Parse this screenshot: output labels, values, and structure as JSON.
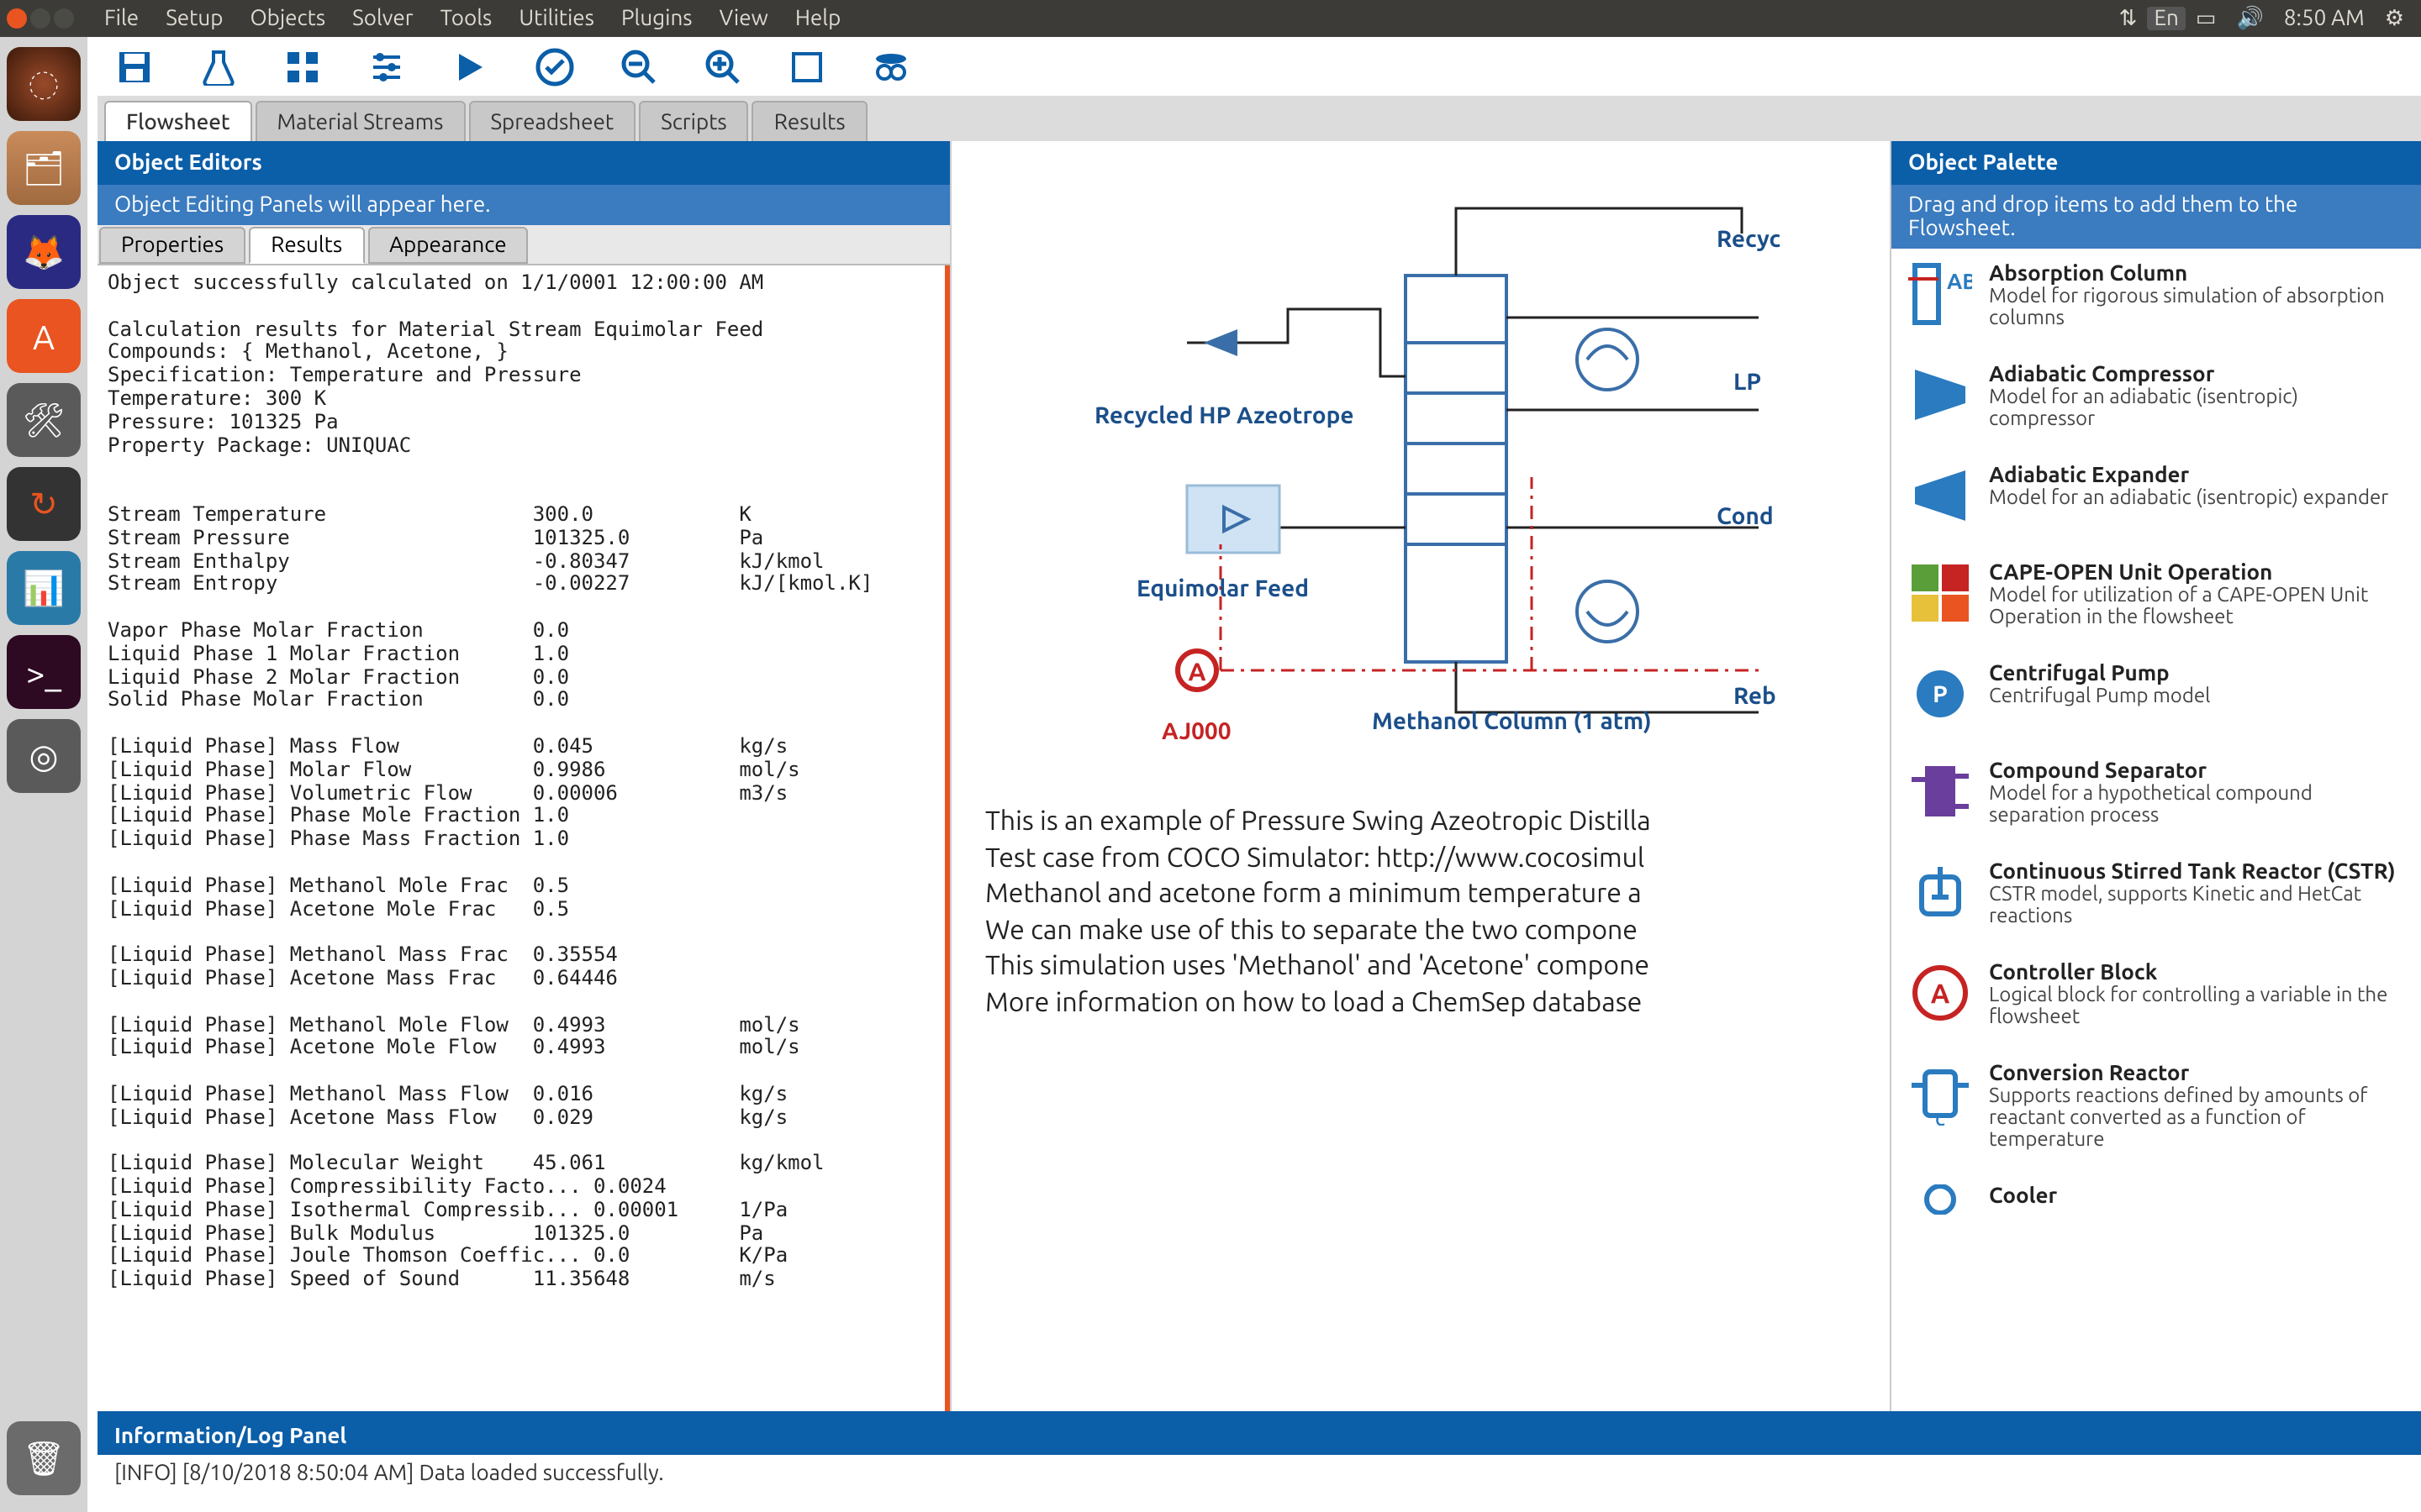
{
  "ubuntu": {
    "menus": [
      "File",
      "Setup",
      "Objects",
      "Solver",
      "Tools",
      "Utilities",
      "Plugins",
      "View",
      "Help"
    ],
    "clock": "8:50 AM",
    "lang": "En"
  },
  "toolbar_icons": [
    "save",
    "flask",
    "grid",
    "sliders",
    "play",
    "check",
    "zoom-out",
    "zoom-in",
    "fit",
    "spy"
  ],
  "tabs": [
    "Flowsheet",
    "Material Streams",
    "Spreadsheet",
    "Scripts",
    "Results"
  ],
  "active_tab": "Flowsheet",
  "left": {
    "header": "Object Editors",
    "sub": "Object Editing Panels will appear here.",
    "sub_tabs": [
      "Properties",
      "Results",
      "Appearance"
    ],
    "active_sub": "Results",
    "results_text": "Object successfully calculated on 1/1/0001 12:00:00 AM\n\nCalculation results for Material Stream Equimolar Feed\nCompounds: { Methanol, Acetone, }\nSpecification: Temperature and Pressure\nTemperature: 300 K\nPressure: 101325 Pa\nProperty Package: UNIQUAC\n\n\nStream Temperature                 300.0            K\nStream Pressure                    101325.0         Pa\nStream Enthalpy                    -0.80347         kJ/kmol\nStream Entropy                     -0.00227         kJ/[kmol.K]\n\nVapor Phase Molar Fraction         0.0\nLiquid Phase 1 Molar Fraction      1.0\nLiquid Phase 2 Molar Fraction      0.0\nSolid Phase Molar Fraction         0.0\n\n[Liquid Phase] Mass Flow           0.045            kg/s\n[Liquid Phase] Molar Flow          0.9986           mol/s\n[Liquid Phase] Volumetric Flow     0.00006          m3/s\n[Liquid Phase] Phase Mole Fraction 1.0\n[Liquid Phase] Phase Mass Fraction 1.0\n\n[Liquid Phase] Methanol Mole Frac  0.5\n[Liquid Phase] Acetone Mole Frac   0.5\n\n[Liquid Phase] Methanol Mass Frac  0.35554\n[Liquid Phase] Acetone Mass Frac   0.64446\n\n[Liquid Phase] Methanol Mole Flow  0.4993           mol/s\n[Liquid Phase] Acetone Mole Flow   0.4993           mol/s\n\n[Liquid Phase] Methanol Mass Flow  0.016            kg/s\n[Liquid Phase] Acetone Mass Flow   0.029            kg/s\n\n[Liquid Phase] Molecular Weight    45.061           kg/kmol\n[Liquid Phase] Compressibility Facto... 0.0024\n[Liquid Phase] Isothermal Compressib... 0.00001     1/Pa\n[Liquid Phase] Bulk Modulus        101325.0         Pa\n[Liquid Phase] Joule Thomson Coeffic... 0.0         K/Pa\n[Liquid Phase] Speed of Sound      11.35648         m/s\n"
  },
  "flowsheet": {
    "labels": {
      "recycled": "Recycled HP Azeotrope",
      "feed": "Equimolar Feed",
      "column": "Methanol Column (1 atm)",
      "recycle_top": "Recyc",
      "lp": "LP",
      "cond": "Cond",
      "reb": "Reb",
      "aj": "AJ000",
      "a_badge": "A"
    },
    "description": [
      "This is an example of Pressure Swing Azeotropic Distilla",
      "Test case from COCO Simulator: http://www.cocosimul",
      "Methanol and acetone form a minimum temperature a",
      "We can make use of this to separate the two compone",
      "This simulation uses 'Methanol' and 'Acetone' compone",
      "More information on how to load a ChemSep database"
    ]
  },
  "palette": {
    "header": "Object Palette",
    "sub": "Drag and drop items to add them to the Flowsheet.",
    "items": [
      {
        "title": "Absorption Column",
        "desc": "Model for rigorous simulation of absorption columns",
        "icon": "abs-col",
        "colors": [
          "#2a7bbf",
          "#c62323"
        ]
      },
      {
        "title": "Adiabatic Compressor",
        "desc": "Model for an adiabatic (isentropic) compressor",
        "icon": "compressor",
        "colors": [
          "#2a7bbf"
        ]
      },
      {
        "title": "Adiabatic Expander",
        "desc": "Model for an adiabatic (isentropic) expander",
        "icon": "expander",
        "colors": [
          "#2a7bbf"
        ]
      },
      {
        "title": "CAPE-OPEN Unit Operation",
        "desc": "Model for utilization of a CAPE-OPEN Unit Operation in the flowsheet",
        "icon": "capeopen",
        "colors": [
          "#5a9e3a",
          "#e95420",
          "#e7c13a"
        ]
      },
      {
        "title": "Centrifugal Pump",
        "desc": "Centrifugal Pump model",
        "icon": "pump",
        "colors": [
          "#2a7bbf"
        ]
      },
      {
        "title": "Compound Separator",
        "desc": "Model for a hypothetical compound separation process",
        "icon": "comp-sep",
        "colors": [
          "#6a3e9c"
        ]
      },
      {
        "title": "Continuous Stirred Tank Reactor (CSTR)",
        "desc": "CSTR model, supports Kinetic and HetCat reactions",
        "icon": "cstr",
        "colors": [
          "#2a7bbf"
        ]
      },
      {
        "title": "Controller Block",
        "desc": "Logical block for controlling a variable in the flowsheet",
        "icon": "controller",
        "colors": [
          "#c62323"
        ]
      },
      {
        "title": "Conversion Reactor",
        "desc": "Supports reactions defined by amounts of reactant converted as a function of temperature",
        "icon": "conv-react",
        "colors": [
          "#2a7bbf"
        ]
      },
      {
        "title": "Cooler",
        "desc": "",
        "icon": "cooler",
        "colors": [
          "#2a7bbf"
        ]
      }
    ]
  },
  "info": {
    "header": "Information/Log Panel",
    "line": "[INFO] [8/10/2018 8:50:04 AM] Data loaded successfully."
  }
}
